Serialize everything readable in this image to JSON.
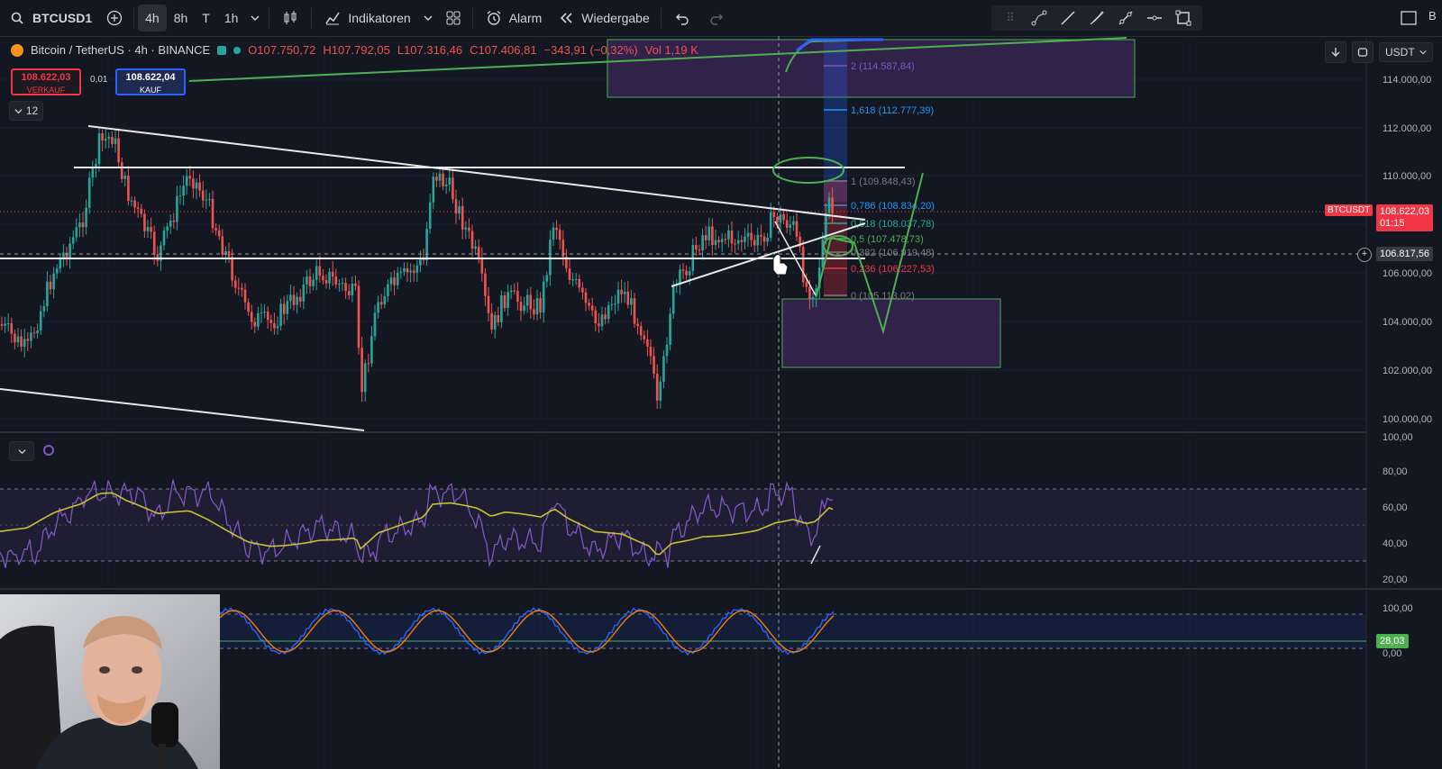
{
  "toolbar": {
    "symbol": "BTCUSD1",
    "intervals": [
      "4h",
      "8h",
      "T",
      "1h"
    ],
    "indicators_label": "Indikatoren",
    "alarm_label": "Alarm",
    "replay_label": "Wiedergabe",
    "right_label": "B"
  },
  "legend": {
    "title": "Bitcoin / TetherUS · 4h · BINANCE",
    "o": "O107.750,72",
    "h": "H107.792,05",
    "l": "L107.316,46",
    "c": "C107.406,81",
    "change": "−343,91 (−0,32%)",
    "vol": "Vol 1,19 K"
  },
  "trade": {
    "sell_price": "108.622,03",
    "sell_label": "VERKAUF",
    "spread": "0,01",
    "buy_price": "108.622,04",
    "buy_label": "KAUF"
  },
  "collapse_count": "12",
  "currency": "USDT",
  "price_axis": [
    "114.000,00",
    "112.000,00",
    "110.000,00",
    "108.000,00",
    "106.000,00",
    "104.000,00",
    "102.000,00",
    "100.000,00"
  ],
  "price_tag": {
    "symbol": "BTCUSDT",
    "price": "108.622,03",
    "countdown": "01:15",
    "color": "#f23645"
  },
  "crosshair_price": "106.817,56",
  "fib_levels": [
    {
      "label": "2 (114.587,84)",
      "color": "#7e57c2"
    },
    {
      "label": "1,618 (112.777,39)",
      "color": "#2196f3"
    },
    {
      "label": "1 (109.848,43)",
      "color": "#787b86"
    },
    {
      "label": "0,786 (108.834,20)",
      "color": "#2196f3"
    },
    {
      "label": "0,618 (108.037,78)",
      "color": "#26a69a"
    },
    {
      "label": "0,5 (107.478,73)",
      "color": "#4caf50"
    },
    {
      "label": "0,382 (106.919,48)",
      "color": "#787b86"
    },
    {
      "label": "0,236 (106.227,53)",
      "color": "#f23645"
    },
    {
      "label": "0 (105.113,02)",
      "color": "#787b86"
    }
  ],
  "rsi_axis": [
    "100,00",
    "80,00",
    "60,00",
    "40,00",
    "20,00"
  ],
  "stoch_axis": [
    "100,00",
    "0,00"
  ],
  "stoch_tag": "28,03",
  "colors": {
    "up": "#26a69a",
    "down": "#ef5350",
    "drawing_green": "#4caf50",
    "rsi": "#7e57c2",
    "rsi_ma": "#c9c035"
  }
}
